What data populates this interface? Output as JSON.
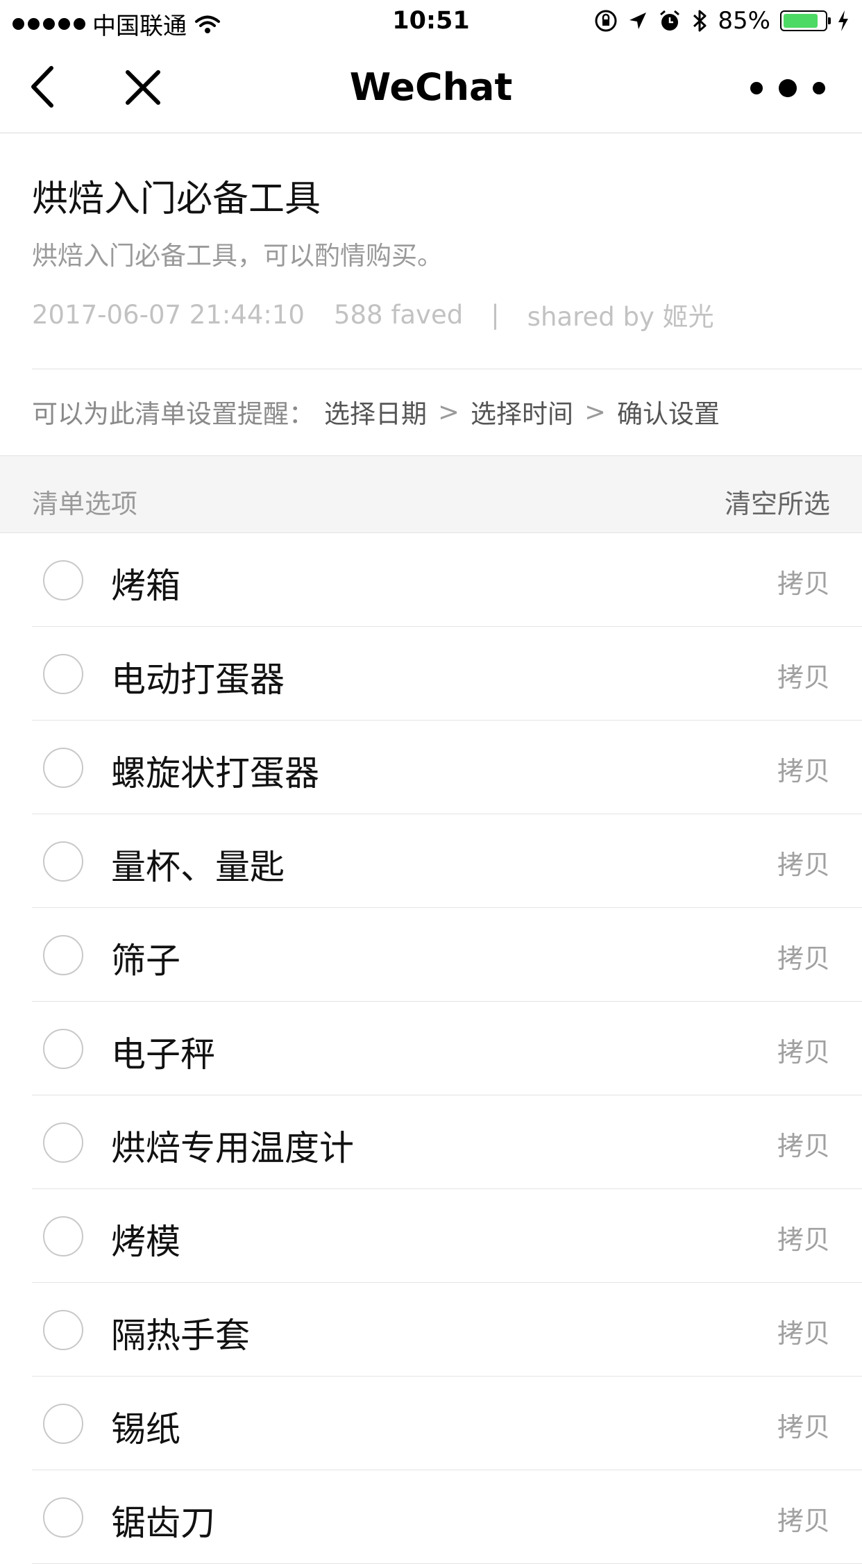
{
  "status_bar": {
    "carrier": "中国联通",
    "time": "10:51",
    "battery_percent": "85%",
    "battery_level": 0.85,
    "icons": [
      "signal-dots-icon",
      "wifi-icon",
      "orientation-lock-icon",
      "location-arrow-icon",
      "alarm-icon",
      "bluetooth-icon",
      "battery-icon",
      "charging-bolt-icon"
    ],
    "battery_color": "#4cd964"
  },
  "nav": {
    "title": "WeChat",
    "icons": [
      "back-icon",
      "close-icon",
      "more-icon"
    ]
  },
  "header": {
    "title": "烘焙入门必备工具",
    "description": "烘焙入门必备工具，可以酌情购买。",
    "date": "2017-06-07 21:44:10",
    "faved": "588 faved",
    "separator": "|",
    "shared_by": "shared by 姬光"
  },
  "reminder": {
    "prompt": "可以为此清单设置提醒：",
    "steps": [
      "选择日期",
      "选择时间",
      "确认设置"
    ],
    "arrow": ">"
  },
  "section": {
    "label": "清单选项",
    "clear_action": "清空所选"
  },
  "items": [
    {
      "name": "烤箱",
      "action": "拷贝"
    },
    {
      "name": "电动打蛋器",
      "action": "拷贝"
    },
    {
      "name": "螺旋状打蛋器",
      "action": "拷贝"
    },
    {
      "name": "量杯、量匙",
      "action": "拷贝"
    },
    {
      "name": "筛子",
      "action": "拷贝"
    },
    {
      "name": "电子秤",
      "action": "拷贝"
    },
    {
      "name": "烘焙专用温度计",
      "action": "拷贝"
    },
    {
      "name": "烤模",
      "action": "拷贝"
    },
    {
      "name": "隔热手套",
      "action": "拷贝"
    },
    {
      "name": "锡纸",
      "action": "拷贝"
    },
    {
      "name": "锯齿刀",
      "action": "拷贝"
    }
  ]
}
